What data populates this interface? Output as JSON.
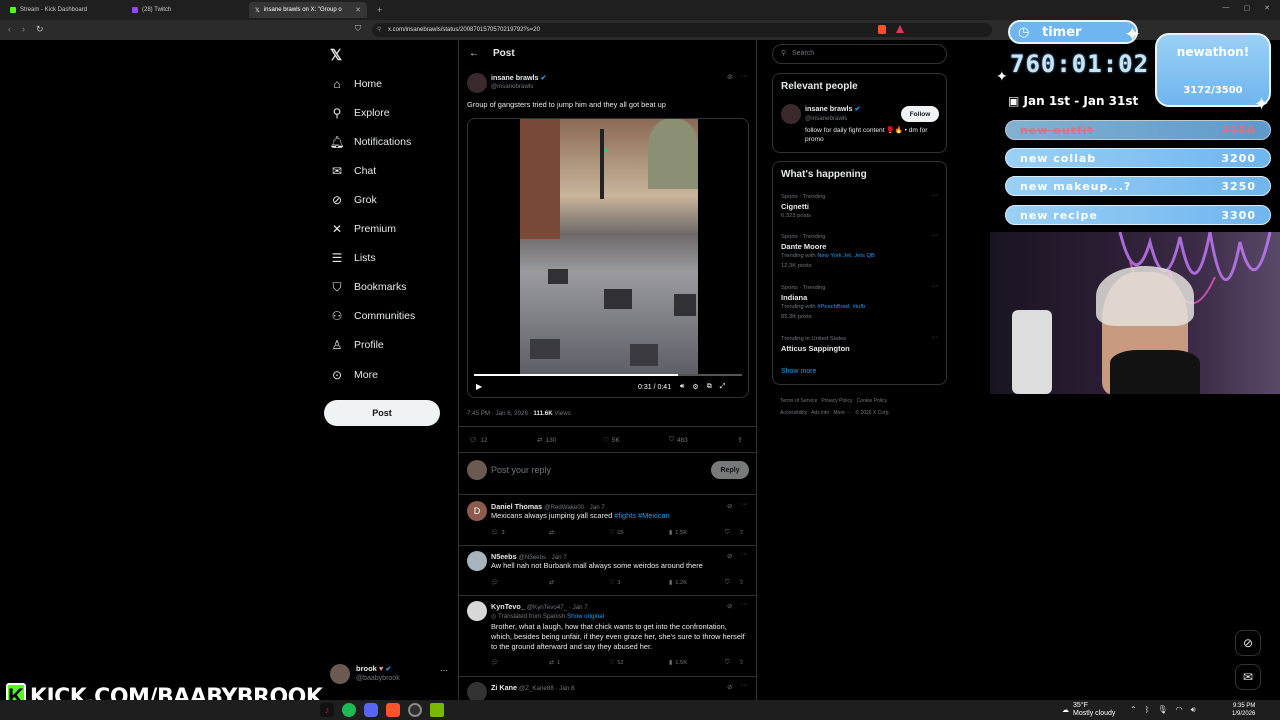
{
  "browser": {
    "tabs": [
      {
        "label": "Stream - Kick Dashboard"
      },
      {
        "label": "(28) Twitch"
      },
      {
        "label": "insane brawls on X: \"Group o"
      }
    ],
    "url": "x.com/insanebrawls/status/2008701570570219792?s=20"
  },
  "nav": {
    "items": [
      {
        "label": "Home",
        "icon": "home-icon"
      },
      {
        "label": "Explore",
        "icon": "search-icon"
      },
      {
        "label": "Notifications",
        "icon": "bell-icon"
      },
      {
        "label": "Chat",
        "icon": "mail-icon"
      },
      {
        "label": "Grok",
        "icon": "grok-icon"
      },
      {
        "label": "Premium",
        "icon": "x-icon"
      },
      {
        "label": "Lists",
        "icon": "list-icon"
      },
      {
        "label": "Bookmarks",
        "icon": "bookmark-icon"
      },
      {
        "label": "Communities",
        "icon": "people-icon"
      },
      {
        "label": "Profile",
        "icon": "person-icon"
      },
      {
        "label": "More",
        "icon": "more-circle-icon"
      }
    ],
    "post_label": "Post",
    "account": {
      "name": "brook",
      "handle": "@baabybrook"
    }
  },
  "post": {
    "header": "Post",
    "author": "insane brawls",
    "handle": "@insanebrawls",
    "text": "Group of gangsters tried to jump him and they all got beat up",
    "video_time": "0:31 / 0:41",
    "video_progress": 0.76,
    "meta_time": "7:45 PM · Jan 6, 2026 · ",
    "views": "111.6K",
    "views_label": " Views",
    "replies": "12",
    "reposts": "130",
    "likes": "5K",
    "bookmarks": "483",
    "reply_placeholder": "Post your reply",
    "reply_button": "Reply"
  },
  "replies": [
    {
      "name": "Daniel Thomas",
      "handle": "@RedWake00 · Jan 7",
      "text": "Mexicans always  jumping yall scared ",
      "tags": "#fights #Mexican",
      "r": "3",
      "rt": "",
      "l": "15",
      "v": "1.5K",
      "initial": "D"
    },
    {
      "name": "N5eebs",
      "handle": "@N5eebs · Jan 7",
      "text": "Aw hell nah not Burbank mall always some weirdos around there",
      "tags": "",
      "r": "",
      "rt": "",
      "l": "3",
      "v": "1.2K",
      "initial": ""
    },
    {
      "name": "KynTevo_",
      "handle": "@KynTevo47_ · Jan 7",
      "translated": "Translated from Spanish",
      "show_original": "Show original",
      "text": "Brother, what a laugh, how that chick wants to get into the confrontation, which, besides being unfair, if they even graze her, she's sure to throw herself to the ground afterward and say they abused her.",
      "tags": "",
      "r": "",
      "rt": "1",
      "l": "12",
      "v": "1.5K",
      "initial": ""
    },
    {
      "name": "Zi Kane",
      "handle": "@Z_Kane88 · Jan 8",
      "text": "",
      "tags": "",
      "r": "",
      "rt": "",
      "l": "",
      "v": "",
      "initial": ""
    }
  ],
  "right": {
    "search_placeholder": "Search",
    "relevant_title": "Relevant people",
    "person": {
      "name": "insane brawls",
      "handle": "@insanebrawls",
      "bio": "follow for daily fight content 🥊🔥 • dm for promo",
      "follow": "Follow"
    },
    "happening_title": "What's happening",
    "trends": [
      {
        "cat": "Sports · Trending",
        "name": "Cignetti",
        "sub": "6,323 posts",
        "with": ""
      },
      {
        "cat": "Sports · Trending",
        "name": "Dante Moore",
        "sub": "12.3K posts",
        "with": "Trending with ",
        "with_links": "New York Jet, Jets QB"
      },
      {
        "cat": "Sports · Trending",
        "name": "Indiana",
        "sub": "85.3K posts",
        "with": "Trending with ",
        "with_links": "#PeachBowl, #iufb"
      },
      {
        "cat": "Trending in United States",
        "name": "Atticus Sappington",
        "sub": "",
        "with": ""
      }
    ],
    "show_more": "Show more",
    "footer": [
      "Terms of Service",
      "Privacy Policy",
      "Cookie Policy",
      "Accessibility",
      "Ads info",
      "More ···",
      "© 2026 X Corp."
    ]
  },
  "overlay": {
    "timer_label": "timer",
    "timer_value": "760:01:02",
    "date_range": "Jan 1st - Jan 31st",
    "subathon_title": "newathon!",
    "subathon_count": "3172/3500",
    "goals": [
      {
        "label": "new outfit",
        "value": "3150"
      },
      {
        "label": "new collab",
        "value": "3200"
      },
      {
        "label": "new makeup...?",
        "value": "3250"
      },
      {
        "label": "new recipe",
        "value": "3300"
      }
    ],
    "kick_banner": "KICK.COM/BAABYBROOK"
  },
  "taskbar": {
    "weather_temp": "35°F",
    "weather_desc": "Mostly cloudy",
    "time": "9:35 PM",
    "date": "1/9/2026"
  },
  "colors": {
    "accent": "#1d9bf0",
    "kick": "#53fc18",
    "overlay": "#8ecbf3"
  }
}
